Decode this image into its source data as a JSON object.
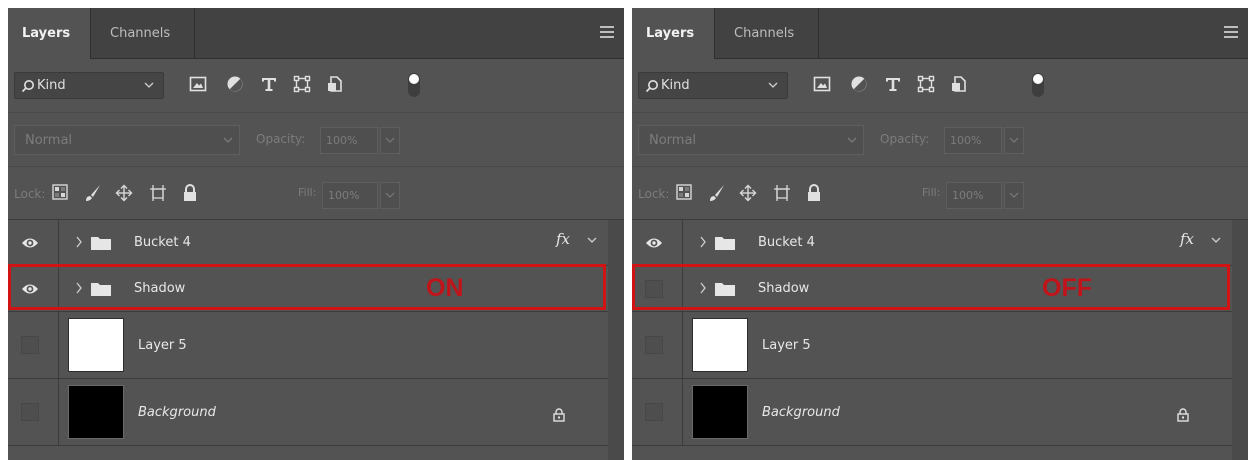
{
  "panels": [
    {
      "tabs": [
        {
          "label": "Layers"
        },
        {
          "label": "Channels"
        }
      ],
      "filter": {
        "kind_label": "Kind"
      },
      "blend": {
        "mode": "Normal",
        "opacity_label": "Opacity:",
        "opacity_value": "100%"
      },
      "lock": {
        "lock_label": "Lock:",
        "fill_label": "Fill:",
        "fill_value": "100%"
      },
      "layers": [
        {
          "name": "Bucket 4",
          "type": "group",
          "visible": true,
          "fx": "fx"
        },
        {
          "name": "Shadow",
          "type": "group",
          "visible": true,
          "annotation": "ON"
        },
        {
          "name": "Layer 5",
          "type": "pixel",
          "visible": false,
          "thumb": "#ffffff"
        },
        {
          "name": "Background",
          "type": "background",
          "visible": false,
          "thumb": "#000000",
          "locked": true
        }
      ]
    },
    {
      "tabs": [
        {
          "label": "Layers"
        },
        {
          "label": "Channels"
        }
      ],
      "filter": {
        "kind_label": "Kind"
      },
      "blend": {
        "mode": "Normal",
        "opacity_label": "Opacity:",
        "opacity_value": "100%"
      },
      "lock": {
        "lock_label": "Lock:",
        "fill_label": "Fill:",
        "fill_value": "100%"
      },
      "layers": [
        {
          "name": "Bucket 4",
          "type": "group",
          "visible": true,
          "fx": "fx"
        },
        {
          "name": "Shadow",
          "type": "group",
          "visible": false,
          "annotation": "OFF"
        },
        {
          "name": "Layer 5",
          "type": "pixel",
          "visible": false,
          "thumb": "#ffffff"
        },
        {
          "name": "Background",
          "type": "background",
          "visible": false,
          "thumb": "#000000",
          "locked": true
        }
      ]
    }
  ],
  "colors": {
    "panel_bg": "#535353",
    "tab_bg": "#424242",
    "highlight": "#d11313",
    "annotation_text": "#c0141a"
  },
  "icons": [
    "search-icon",
    "image-filter-icon",
    "adjustment-filter-icon",
    "type-filter-icon",
    "shape-filter-icon",
    "smart-object-filter-icon",
    "filter-toggle",
    "lock-pixels-icon",
    "lock-image-icon",
    "lock-position-icon",
    "lock-artboard-icon",
    "lock-all-icon",
    "eye-icon",
    "folder-icon",
    "lock-badge-icon"
  ]
}
